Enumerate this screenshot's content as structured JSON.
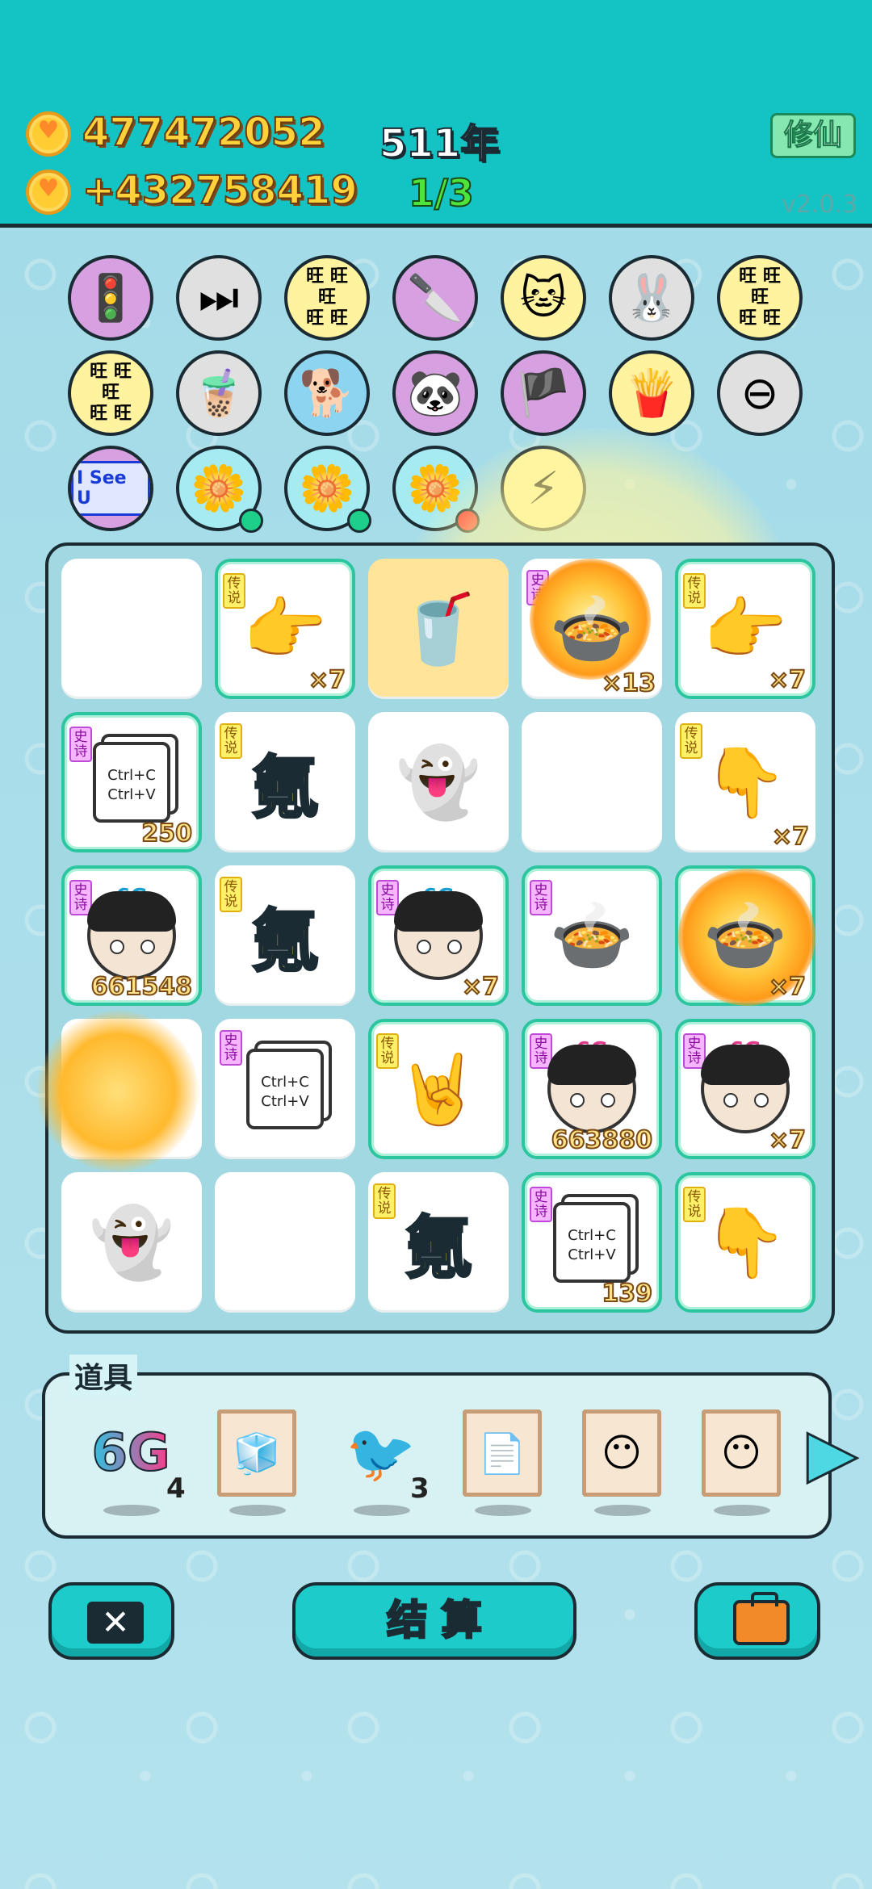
{
  "header": {
    "coins_total": "477472052",
    "coins_rate": "+432758419",
    "year": "511年",
    "progress": "1/3",
    "cultivate_button": "修仙",
    "version": "v2.0.3"
  },
  "skills": [
    {
      "icon": "ghost-traffic-light-icon",
      "color": "purple",
      "glyph": "🚦"
    },
    {
      "icon": "skip-icon",
      "color": "gray",
      "glyph": "⏭"
    },
    {
      "icon": "wang-grid-icon",
      "color": "yellow",
      "glyph": "旺"
    },
    {
      "icon": "cleaver-icon",
      "color": "purple",
      "glyph": "🔪"
    },
    {
      "icon": "cat-icon",
      "color": "yellow",
      "glyph": "🐱"
    },
    {
      "icon": "rabbit-icon",
      "color": "gray",
      "glyph": "🐰"
    },
    {
      "icon": "wang-grid-icon",
      "color": "yellow",
      "glyph": "旺"
    },
    {
      "icon": "wang-grid-icon",
      "color": "yellow",
      "glyph": "旺"
    },
    {
      "icon": "bubble-tea-icon",
      "color": "gray",
      "glyph": "🧋"
    },
    {
      "icon": "dog-icon",
      "color": "blue",
      "glyph": "🐕"
    },
    {
      "icon": "panda-icon",
      "color": "purple",
      "glyph": "🐼"
    },
    {
      "icon": "pirate-icon",
      "color": "purple",
      "glyph": "🏴"
    },
    {
      "icon": "fries-icon",
      "color": "yellow",
      "glyph": "🍟"
    },
    {
      "icon": "minus-icon",
      "color": "gray",
      "glyph": "⊖"
    },
    {
      "icon": "i-see-u-icon",
      "color": "purple",
      "glyph": "I See U"
    },
    {
      "icon": "flower-pot-icon",
      "color": "cyan",
      "glyph": "🌼"
    },
    {
      "icon": "flower-pot-icon",
      "color": "cyan",
      "glyph": "🌼"
    },
    {
      "icon": "flower-pot-icon",
      "color": "cyan",
      "glyph": "🌼"
    },
    {
      "icon": "lightning-icon",
      "color": "yellow",
      "glyph": "⚡"
    }
  ],
  "board": {
    "labels": {
      "legend": "传说",
      "epic": "史诗"
    },
    "text_char": "氪",
    "copy_paste_text": "Ctrl+C Ctrl+V",
    "crown_text": "6G",
    "counts": {
      "r1c2": "×7",
      "r1c4": "×13",
      "r1c5": "×7",
      "r2c1": "250",
      "r2c5": "×7",
      "r3c1": "661548",
      "r3c3": "×7",
      "r3c5": "×7",
      "r4c4": "663880",
      "r4c5": "×7",
      "r5c4": "139"
    }
  },
  "items": {
    "title": "道具",
    "sixg_label": "6G",
    "sixg_count": "4",
    "bird_count": "3"
  },
  "buttons": {
    "settle": "结 算"
  },
  "colors": {
    "header_bg": "#14c3c3",
    "accent": "#1ecbcb",
    "legend_tag": "#fff06a",
    "epic_tag": "#f6b6ff"
  }
}
